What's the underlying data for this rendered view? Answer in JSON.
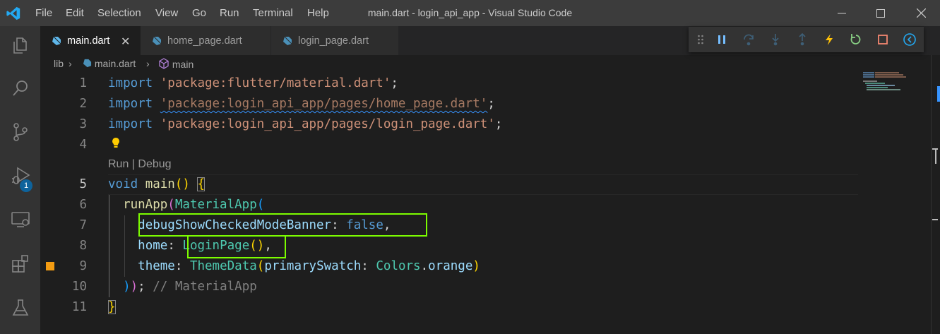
{
  "window": {
    "title": "main.dart - login_api_app - Visual Studio Code",
    "menu": [
      "File",
      "Edit",
      "Selection",
      "View",
      "Go",
      "Run",
      "Terminal",
      "Help"
    ],
    "controls": [
      "minimize-icon",
      "maximize-icon",
      "close-icon"
    ]
  },
  "activity_bar": {
    "items": [
      "explorer-icon",
      "search-icon",
      "source-control-icon",
      "run-debug-icon",
      "remote-explorer-icon",
      "extensions-icon",
      "testing-icon"
    ],
    "debug_badge": "1"
  },
  "tabs": [
    {
      "label": "main.dart",
      "active": true,
      "close": "✕"
    },
    {
      "label": "home_page.dart",
      "active": false
    },
    {
      "label": "login_page.dart",
      "active": false
    }
  ],
  "debug_toolbar": [
    "drag-grip-icon",
    "pause-icon",
    "step-over-icon",
    "step-into-icon",
    "step-out-icon",
    "hot-reload-icon",
    "restart-icon",
    "stop-icon",
    "devtools-icon"
  ],
  "breadcrumb": {
    "folder": "lib",
    "file": "main.dart",
    "symbol": "main",
    "sep": "›"
  },
  "editor": {
    "active_line": 5,
    "codelens": "Run | Debug",
    "lines": {
      "l1": {
        "num": "1",
        "kw": "import",
        "str": "'package:flutter/material.dart'",
        "end": ";"
      },
      "l2": {
        "num": "2",
        "kw": "import",
        "str": "'package:login_api_app/pages/home_page.dart'",
        "end": ";"
      },
      "l3": {
        "num": "3",
        "kw": "import",
        "str": "'package:login_api_app/pages/login_page.dart'",
        "end": ";"
      },
      "l4": {
        "num": "4"
      },
      "l5": {
        "num": "5",
        "kw": "void",
        "fn": "main",
        "paren": "()",
        "brace": "{"
      },
      "l6": {
        "num": "6",
        "fn": "runApp",
        "p": "(",
        "ty": "MaterialApp",
        "p2": "("
      },
      "l7": {
        "num": "7",
        "prop": "debugShowCheckedModeBanner",
        "colon": ":",
        "val": "false",
        "comma": ","
      },
      "l8": {
        "num": "8",
        "prop": "home",
        "colon": ":",
        "ty": "LoginPage",
        "paren": "()",
        "comma": ","
      },
      "l9": {
        "num": "9",
        "prop": "theme",
        "colon": ":",
        "ty": "ThemeData",
        "p": "(",
        "prop2": "primarySwatch",
        "colon2": ":",
        "ty2": "Colors",
        "dot": ".",
        "prop3": "orange",
        "p2": ")"
      },
      "l10": {
        "num": "10",
        "p1": ")",
        "p2": ")",
        "semi": ";",
        "comment": "// MaterialApp"
      },
      "l11": {
        "num": "11",
        "brace": "}"
      }
    }
  },
  "colors": {
    "highlight_box": "#7cfc00",
    "modified_marker": "#f39c12",
    "accent": "#0e639c"
  }
}
